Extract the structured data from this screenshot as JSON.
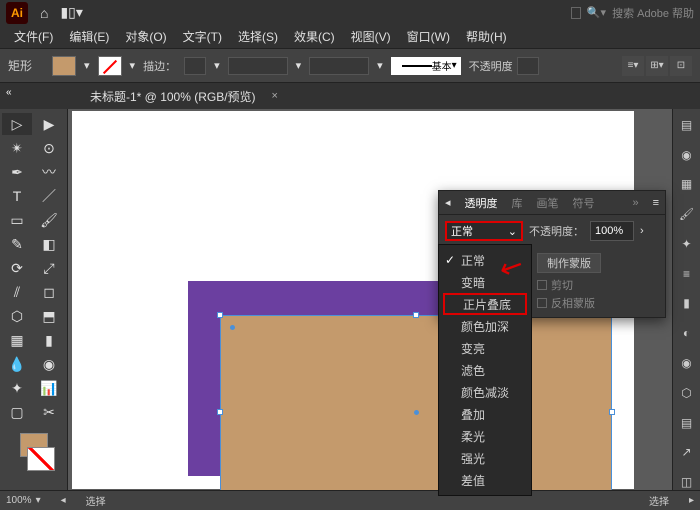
{
  "topbar": {
    "logo": "Ai",
    "search_placeholder": "搜索 Adobe 帮助"
  },
  "menu": {
    "file": "文件(F)",
    "edit": "编辑(E)",
    "object": "对象(O)",
    "type": "文字(T)",
    "select": "选择(S)",
    "effect": "效果(C)",
    "view": "视图(V)",
    "window": "窗口(W)",
    "help": "帮助(H)"
  },
  "ctrlbar": {
    "shape": "矩形",
    "stroke_label": "描边：",
    "stroke_style": "基本",
    "opacity_label": "不透明度"
  },
  "doc": {
    "title": "未标题-1* @ 100% (RGB/预览)",
    "hint": "«"
  },
  "panel": {
    "tabs": {
      "transparency": "透明度",
      "lib": "库",
      "brushes": "画笔",
      "symbols": "符号",
      "more": "»"
    },
    "blend_value": "正常",
    "opacity_label": "不透明度：",
    "opacity_value": "100%",
    "make_mask": "制作蒙版",
    "clip": "剪切",
    "invert": "反相蒙版"
  },
  "blend_modes": {
    "normal": "正常",
    "darken": "变暗",
    "multiply": "正片叠底",
    "color_burn": "颜色加深",
    "lighten": "变亮",
    "screen": "滤色",
    "color_dodge": "颜色减淡",
    "overlay": "叠加",
    "soft_light": "柔光",
    "hard_light": "强光",
    "difference": "差值"
  },
  "status": {
    "zoom": "100%",
    "select_left": "选择",
    "select_right": "选择"
  }
}
